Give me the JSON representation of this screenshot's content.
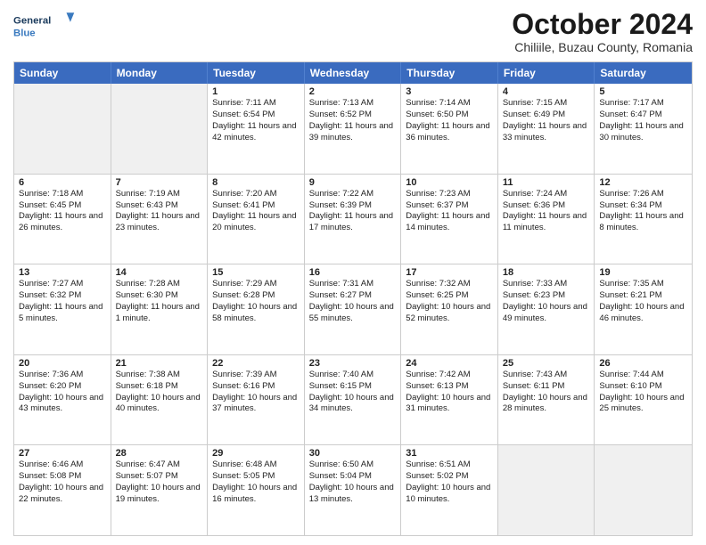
{
  "header": {
    "logo_general": "General",
    "logo_blue": "Blue",
    "title": "October 2024",
    "location": "Chiliile, Buzau County, Romania"
  },
  "days_of_week": [
    "Sunday",
    "Monday",
    "Tuesday",
    "Wednesday",
    "Thursday",
    "Friday",
    "Saturday"
  ],
  "weeks": [
    [
      {
        "day": "",
        "sunrise": "",
        "sunset": "",
        "daylight": "",
        "shaded": true
      },
      {
        "day": "",
        "sunrise": "",
        "sunset": "",
        "daylight": "",
        "shaded": true
      },
      {
        "day": "1",
        "sunrise": "Sunrise: 7:11 AM",
        "sunset": "Sunset: 6:54 PM",
        "daylight": "Daylight: 11 hours and 42 minutes.",
        "shaded": false
      },
      {
        "day": "2",
        "sunrise": "Sunrise: 7:13 AM",
        "sunset": "Sunset: 6:52 PM",
        "daylight": "Daylight: 11 hours and 39 minutes.",
        "shaded": false
      },
      {
        "day": "3",
        "sunrise": "Sunrise: 7:14 AM",
        "sunset": "Sunset: 6:50 PM",
        "daylight": "Daylight: 11 hours and 36 minutes.",
        "shaded": false
      },
      {
        "day": "4",
        "sunrise": "Sunrise: 7:15 AM",
        "sunset": "Sunset: 6:49 PM",
        "daylight": "Daylight: 11 hours and 33 minutes.",
        "shaded": false
      },
      {
        "day": "5",
        "sunrise": "Sunrise: 7:17 AM",
        "sunset": "Sunset: 6:47 PM",
        "daylight": "Daylight: 11 hours and 30 minutes.",
        "shaded": false
      }
    ],
    [
      {
        "day": "6",
        "sunrise": "Sunrise: 7:18 AM",
        "sunset": "Sunset: 6:45 PM",
        "daylight": "Daylight: 11 hours and 26 minutes.",
        "shaded": false
      },
      {
        "day": "7",
        "sunrise": "Sunrise: 7:19 AM",
        "sunset": "Sunset: 6:43 PM",
        "daylight": "Daylight: 11 hours and 23 minutes.",
        "shaded": false
      },
      {
        "day": "8",
        "sunrise": "Sunrise: 7:20 AM",
        "sunset": "Sunset: 6:41 PM",
        "daylight": "Daylight: 11 hours and 20 minutes.",
        "shaded": false
      },
      {
        "day": "9",
        "sunrise": "Sunrise: 7:22 AM",
        "sunset": "Sunset: 6:39 PM",
        "daylight": "Daylight: 11 hours and 17 minutes.",
        "shaded": false
      },
      {
        "day": "10",
        "sunrise": "Sunrise: 7:23 AM",
        "sunset": "Sunset: 6:37 PM",
        "daylight": "Daylight: 11 hours and 14 minutes.",
        "shaded": false
      },
      {
        "day": "11",
        "sunrise": "Sunrise: 7:24 AM",
        "sunset": "Sunset: 6:36 PM",
        "daylight": "Daylight: 11 hours and 11 minutes.",
        "shaded": false
      },
      {
        "day": "12",
        "sunrise": "Sunrise: 7:26 AM",
        "sunset": "Sunset: 6:34 PM",
        "daylight": "Daylight: 11 hours and 8 minutes.",
        "shaded": false
      }
    ],
    [
      {
        "day": "13",
        "sunrise": "Sunrise: 7:27 AM",
        "sunset": "Sunset: 6:32 PM",
        "daylight": "Daylight: 11 hours and 5 minutes.",
        "shaded": false
      },
      {
        "day": "14",
        "sunrise": "Sunrise: 7:28 AM",
        "sunset": "Sunset: 6:30 PM",
        "daylight": "Daylight: 11 hours and 1 minute.",
        "shaded": false
      },
      {
        "day": "15",
        "sunrise": "Sunrise: 7:29 AM",
        "sunset": "Sunset: 6:28 PM",
        "daylight": "Daylight: 10 hours and 58 minutes.",
        "shaded": false
      },
      {
        "day": "16",
        "sunrise": "Sunrise: 7:31 AM",
        "sunset": "Sunset: 6:27 PM",
        "daylight": "Daylight: 10 hours and 55 minutes.",
        "shaded": false
      },
      {
        "day": "17",
        "sunrise": "Sunrise: 7:32 AM",
        "sunset": "Sunset: 6:25 PM",
        "daylight": "Daylight: 10 hours and 52 minutes.",
        "shaded": false
      },
      {
        "day": "18",
        "sunrise": "Sunrise: 7:33 AM",
        "sunset": "Sunset: 6:23 PM",
        "daylight": "Daylight: 10 hours and 49 minutes.",
        "shaded": false
      },
      {
        "day": "19",
        "sunrise": "Sunrise: 7:35 AM",
        "sunset": "Sunset: 6:21 PM",
        "daylight": "Daylight: 10 hours and 46 minutes.",
        "shaded": false
      }
    ],
    [
      {
        "day": "20",
        "sunrise": "Sunrise: 7:36 AM",
        "sunset": "Sunset: 6:20 PM",
        "daylight": "Daylight: 10 hours and 43 minutes.",
        "shaded": false
      },
      {
        "day": "21",
        "sunrise": "Sunrise: 7:38 AM",
        "sunset": "Sunset: 6:18 PM",
        "daylight": "Daylight: 10 hours and 40 minutes.",
        "shaded": false
      },
      {
        "day": "22",
        "sunrise": "Sunrise: 7:39 AM",
        "sunset": "Sunset: 6:16 PM",
        "daylight": "Daylight: 10 hours and 37 minutes.",
        "shaded": false
      },
      {
        "day": "23",
        "sunrise": "Sunrise: 7:40 AM",
        "sunset": "Sunset: 6:15 PM",
        "daylight": "Daylight: 10 hours and 34 minutes.",
        "shaded": false
      },
      {
        "day": "24",
        "sunrise": "Sunrise: 7:42 AM",
        "sunset": "Sunset: 6:13 PM",
        "daylight": "Daylight: 10 hours and 31 minutes.",
        "shaded": false
      },
      {
        "day": "25",
        "sunrise": "Sunrise: 7:43 AM",
        "sunset": "Sunset: 6:11 PM",
        "daylight": "Daylight: 10 hours and 28 minutes.",
        "shaded": false
      },
      {
        "day": "26",
        "sunrise": "Sunrise: 7:44 AM",
        "sunset": "Sunset: 6:10 PM",
        "daylight": "Daylight: 10 hours and 25 minutes.",
        "shaded": false
      }
    ],
    [
      {
        "day": "27",
        "sunrise": "Sunrise: 6:46 AM",
        "sunset": "Sunset: 5:08 PM",
        "daylight": "Daylight: 10 hours and 22 minutes.",
        "shaded": false
      },
      {
        "day": "28",
        "sunrise": "Sunrise: 6:47 AM",
        "sunset": "Sunset: 5:07 PM",
        "daylight": "Daylight: 10 hours and 19 minutes.",
        "shaded": false
      },
      {
        "day": "29",
        "sunrise": "Sunrise: 6:48 AM",
        "sunset": "Sunset: 5:05 PM",
        "daylight": "Daylight: 10 hours and 16 minutes.",
        "shaded": false
      },
      {
        "day": "30",
        "sunrise": "Sunrise: 6:50 AM",
        "sunset": "Sunset: 5:04 PM",
        "daylight": "Daylight: 10 hours and 13 minutes.",
        "shaded": false
      },
      {
        "day": "31",
        "sunrise": "Sunrise: 6:51 AM",
        "sunset": "Sunset: 5:02 PM",
        "daylight": "Daylight: 10 hours and 10 minutes.",
        "shaded": false
      },
      {
        "day": "",
        "sunrise": "",
        "sunset": "",
        "daylight": "",
        "shaded": true
      },
      {
        "day": "",
        "sunrise": "",
        "sunset": "",
        "daylight": "",
        "shaded": true
      }
    ]
  ]
}
